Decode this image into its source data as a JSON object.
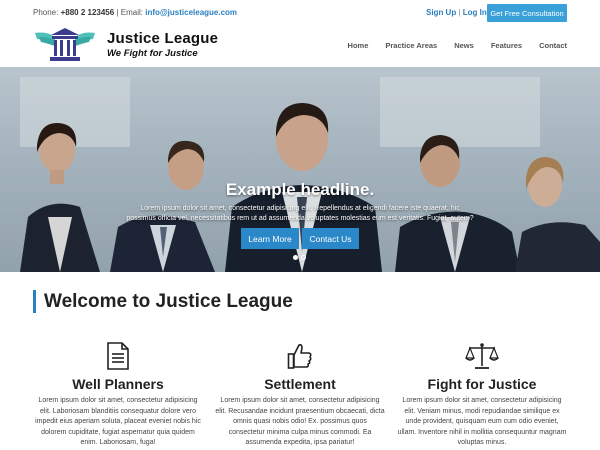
{
  "topbar": {
    "phone_label": "Phone:",
    "phone_value": "+880 2 123456",
    "separator": "|",
    "email_label": "Email:",
    "email_value": "info@justiceleague.com",
    "signup": "Sign Up",
    "auth_sep": "|",
    "login": "Log In",
    "cta": "Get Free Consultation"
  },
  "brand": {
    "name": "Justice League",
    "tagline": "We Fight for Justice",
    "logo_icon": "courthouse-icon"
  },
  "nav": [
    "Home",
    "Practice Areas",
    "News",
    "Features",
    "Contact"
  ],
  "hero": {
    "headline": "Example headline.",
    "text": "Lorem ipsum dolor sit amet, consectetur adipisicing elit. Repellendus at eligendi facere iste quaerat, hic possimus officia vel, necessitatibus rem ut ad assumenda voluptates molestias eum est veritatis. Fugiat, autem?",
    "btn_learn": "Learn More",
    "btn_contact": "Contact Us",
    "slides": 2,
    "active_slide": 1
  },
  "welcome": "Welcome to Justice League",
  "features": [
    {
      "icon": "document-icon",
      "title": "Well Planners",
      "text": "Lorem ipsum dolor sit amet, consectetur adipisicing elit. Laboriosam blanditiis consequatur dolore vero impedit eius aperiam soluta, placeat eveniet nobis hic dolorem cupiditate, fugiat aspernatur quia quidem enim. Laboriosam, fuga!"
    },
    {
      "icon": "thumbs-up-icon",
      "title": "Settlement",
      "text": "Lorem ipsum dolor sit amet, consectetur adipisicing elit. Recusandae incidunt praesentium obcaecati, dicta omnis quasi nobis odio! Ex. possimus quos consectetur minima culpa minus commodi. Ea assumenda expedita, ipsa pariatur!"
    },
    {
      "icon": "scales-icon",
      "title": "Fight for Justice",
      "text": "Lorem ipsum dolor sit amet, consectetur adipisicing elit. Veniam minus, modi repudiandae similique ex unde provident, quisquam eum cum odio eveniet, ullam. Inventore nihil in mollitia consequuntur magnam voluptas minus."
    }
  ],
  "colors": {
    "accent": "#2a7fc1",
    "cta": "#3aa0d8",
    "logo_wings": "#4ec0b8",
    "logo_building": "#3b3d8c"
  }
}
